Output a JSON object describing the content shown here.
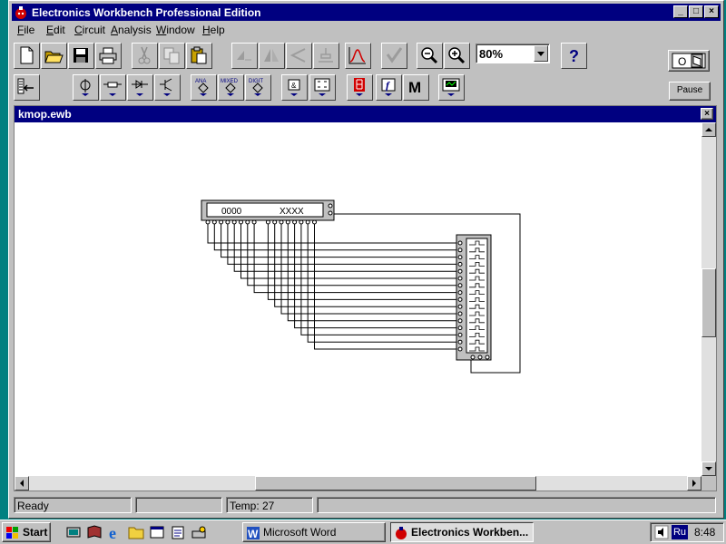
{
  "window": {
    "title": "Electronics Workbench Professional Edition",
    "controls": {
      "minimize": "_",
      "maximize": "□",
      "close": "×"
    }
  },
  "menu": [
    {
      "label": "File",
      "accel": "F"
    },
    {
      "label": "Edit",
      "accel": "E"
    },
    {
      "label": "Circuit",
      "accel": "C"
    },
    {
      "label": "Analysis",
      "accel": "A"
    },
    {
      "label": "Window",
      "accel": "W"
    },
    {
      "label": "Help",
      "accel": "H"
    }
  ],
  "toolbar": {
    "zoom_value": "80%",
    "pause_label": "Pause",
    "help_icon": "question-mark-icon"
  },
  "parts_bin": {
    "ana_label": "ANA",
    "mixed_label": "MIXED",
    "digit_label": "DIGIT",
    "m_label": "M"
  },
  "document": {
    "title": "kmop.ewb",
    "close": "×"
  },
  "circuit": {
    "word_generator_left": "0000",
    "word_generator_right": "XXXX",
    "channels": 16
  },
  "status": {
    "state": "Ready",
    "temp": "Temp:  27"
  },
  "taskbar": {
    "start_label": "Start",
    "tasks": [
      "Microsoft Word",
      "Electronics Workben..."
    ],
    "language": "Ru",
    "clock": "8:48"
  },
  "colors": {
    "title_bar": "#000080",
    "desktop": "#008080",
    "face": "#c0c0c0"
  }
}
